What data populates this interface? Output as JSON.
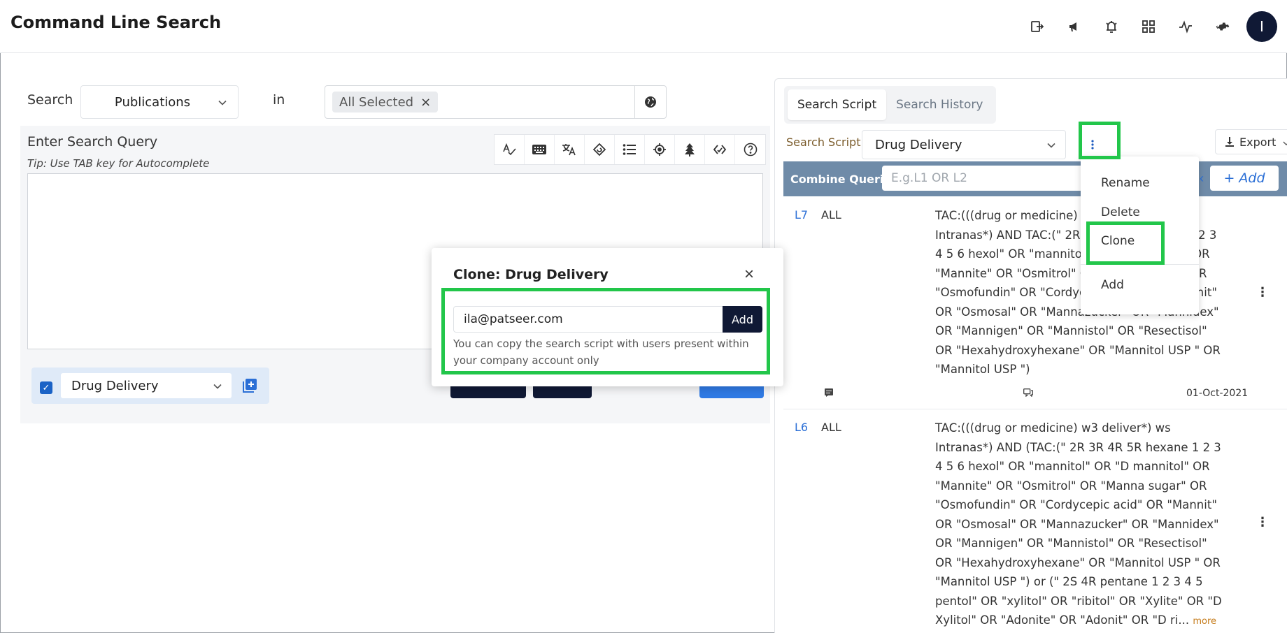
{
  "header": {
    "title": "Command Line Search",
    "icons": [
      "logout-icon",
      "megaphone-icon",
      "alarm-icon",
      "apps-grid-icon",
      "activity-icon",
      "gear-icon"
    ],
    "avatar_initial": "I"
  },
  "search": {
    "label": "Search",
    "source": "Publications",
    "in_label": "in",
    "collection_tag": "All Selected",
    "tag_remove": "×"
  },
  "query": {
    "title": "Enter Search Query",
    "tip": "Tip: Use TAB key for Autocomplete",
    "tools": [
      "spellcheck-icon",
      "keyboard-icon",
      "translate-icon",
      "history-icon",
      "list-icon",
      "target-icon",
      "tree-icon",
      "code-icon",
      "help-icon"
    ],
    "value": ""
  },
  "script_selector": {
    "checked": true,
    "value": "Drug Delivery"
  },
  "right_panel": {
    "tabs": [
      {
        "label": "Search Script",
        "active": true
      },
      {
        "label": "Search History",
        "active": false
      }
    ],
    "script_label": "Search Script :",
    "script_value": "Drug Delivery",
    "export_label": "Export",
    "combine_label": "Combine Queries",
    "combine_placeholder": "E.g.L1 OR L2",
    "add_label": "+ Add"
  },
  "dropdown_menu": {
    "items": [
      "Rename",
      "Delete",
      "Clone",
      "Add"
    ]
  },
  "queries": [
    {
      "id": "L7",
      "db": "ALL",
      "text": "TAC:(((drug or medicine) w3 deliver*) ws Intranas*) AND TAC:(\" 2R 3R 4R 5R hexane 1 2 3 4 5 6 hexol\" OR \"mannitol\" OR \"D mannitol\" OR \"Mannite\" OR \"Osmitrol\" OR \"Manna sugar\" OR \"Osmofundin\" OR \"Cordycepic acid\" OR \"Mannit\" OR \"Osmosal\" OR \"Mannazucker\" OR \"Mannidex\" OR \"Mannigen\" OR \"Mannistol\" OR \"Resectisol\" OR \"Hexahydroxyhexane\" OR \"Mannitol USP \" OR \"Mannitol USP \")",
      "date": "01-Oct-2021"
    },
    {
      "id": "L6",
      "db": "ALL",
      "text": "TAC:(((drug or medicine) w3 deliver*) ws Intranas*) AND (TAC:(\" 2R 3R 4R 5R hexane 1 2 3 4 5 6 hexol\" OR \"mannitol\" OR \"D mannitol\" OR \"Mannite\" OR \"Osmitrol\" OR \"Manna sugar\" OR \"Osmofundin\" OR \"Cordycepic acid\" OR \"Mannit\" OR \"Osmosal\" OR \"Mannazucker\" OR \"Mannidex\" OR \"Mannigen\" OR \"Mannistol\" OR \"Resectisol\" OR \"Hexahydroxyhexane\" OR \"Mannitol USP \" OR \"Mannitol USP \") or (\" 2S 4R pentane 1 2 3 4 5 pentol\" OR \"xylitol\" OR \"ribitol\" OR \"Xylite\" OR \"D Xylitol\" OR \"Adonite\" OR \"Adonit\" OR \"D ri...",
      "more": "more"
    }
  ],
  "modal": {
    "title": "Clone: Drug Delivery",
    "close": "×",
    "email": "ila@patseer.com",
    "add_label": "Add",
    "note": "You can copy the search script with users present within your company account only"
  },
  "highlight_color": "#22c64a"
}
